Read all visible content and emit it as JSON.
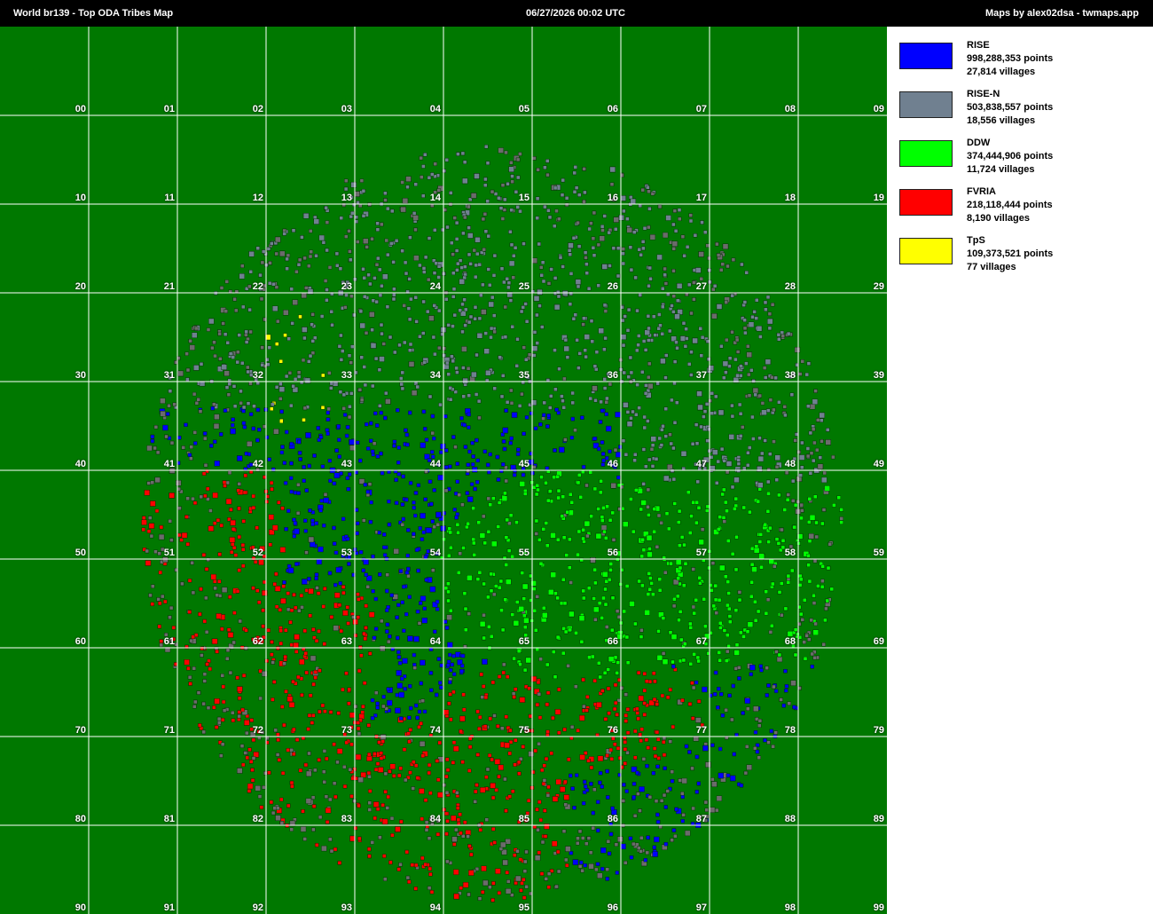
{
  "header": {
    "title": "World br139  -  Top ODA Tribes Map",
    "timestamp": "06/27/2026 00:02 UTC",
    "credit": "Maps by alex02dsa - twmaps.app"
  },
  "map": {
    "background_color": "#007800",
    "grid_color": "#ffffff",
    "sector_labels": [
      "00",
      "01",
      "02",
      "03",
      "04",
      "05",
      "06",
      "07",
      "08",
      "09",
      "10",
      "11",
      "12",
      "13",
      "14",
      "15",
      "16",
      "17",
      "18",
      "19",
      "20",
      "21",
      "22",
      "23",
      "24",
      "25",
      "26",
      "27",
      "28",
      "29",
      "30",
      "31",
      "32",
      "33",
      "34",
      "35",
      "36",
      "37",
      "38",
      "39",
      "40",
      "41",
      "42",
      "43",
      "44",
      "45",
      "46",
      "47",
      "48",
      "49",
      "50",
      "51",
      "52",
      "53",
      "54",
      "55",
      "56",
      "57",
      "58",
      "59",
      "60",
      "61",
      "62",
      "63",
      "64",
      "65",
      "66",
      "67",
      "68",
      "69",
      "70",
      "71",
      "72",
      "73",
      "74",
      "75",
      "76",
      "77",
      "78",
      "79",
      "80",
      "81",
      "82",
      "83",
      "84",
      "85",
      "86",
      "87",
      "88",
      "89",
      "90",
      "91",
      "92",
      "93",
      "94",
      "95",
      "96",
      "97",
      "98",
      "99"
    ]
  },
  "legend": [
    {
      "name": "RISE",
      "points": "998,288,353 points",
      "villages": "27,814 villages",
      "color": "#0000ff"
    },
    {
      "name": "RISE-N",
      "points": "503,838,557 points",
      "villages": "18,556 villages",
      "color": "#708090"
    },
    {
      "name": "DDW",
      "points": "374,444,906 points",
      "villages": "11,724 villages",
      "color": "#00ff00"
    },
    {
      "name": "FVRIA",
      "points": "218,118,444 points",
      "villages": "8,190 villages",
      "color": "#ff0000"
    },
    {
      "name": "TpS",
      "points": "109,373,521 points",
      "villages": "77 villages",
      "color": "#ffff00"
    }
  ]
}
